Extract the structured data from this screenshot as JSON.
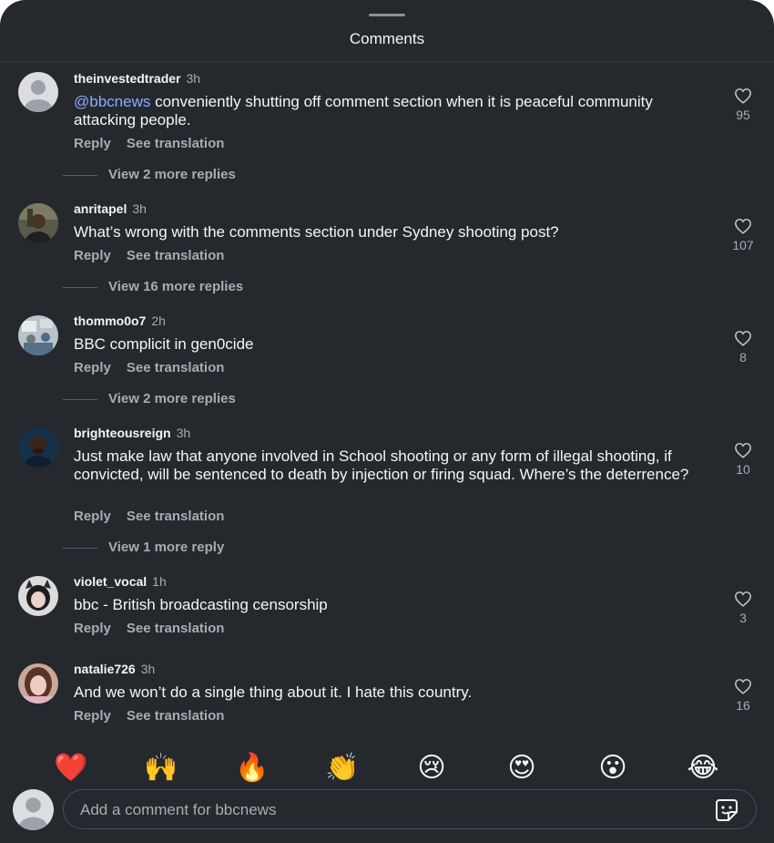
{
  "header": {
    "title": "Comments"
  },
  "comments": [
    {
      "username": "theinvestedtrader",
      "time": "3h",
      "mention": "@bbcnews",
      "text": " conveniently shutting off comment section when it is peaceful community attacking people.",
      "reply_label": "Reply",
      "translate_label": "See translation",
      "view_replies": "View 2 more replies",
      "likes": "95",
      "avatar": "default-avatar"
    },
    {
      "username": "anritapel",
      "time": "3h",
      "text": "What’s wrong with the comments section under Sydney shooting post?",
      "reply_label": "Reply",
      "translate_label": "See translation",
      "view_replies": "View 16 more replies",
      "likes": "107",
      "avatar": "photo-avatar"
    },
    {
      "username": "thommo0o7",
      "time": "2h",
      "text": "BBC complicit in gen0cide",
      "reply_label": "Reply",
      "translate_label": "See translation",
      "view_replies": "View 2 more replies",
      "likes": "8",
      "avatar": "photo-avatar"
    },
    {
      "username": "brighteousreign",
      "time": "3h",
      "text": "Just make law that anyone involved in School shooting or any form of illegal shooting, if convicted, will be sentenced to death by injection or firing squad. Where’s the deterrence?",
      "reply_label": "Reply",
      "translate_label": "See translation",
      "view_replies": "View 1 more reply",
      "likes": "10",
      "avatar": "photo-avatar"
    },
    {
      "username": "violet_vocal",
      "time": "1h",
      "text": "bbc - British broadcasting censorship",
      "reply_label": "Reply",
      "translate_label": "See translation",
      "likes": "3",
      "avatar": "photo-avatar"
    },
    {
      "username": "natalie726",
      "time": "3h",
      "text": "And we won’t do a single thing about it. I hate this country.",
      "reply_label": "Reply",
      "translate_label": "See translation",
      "likes": "16",
      "avatar": "photo-avatar"
    }
  ],
  "reactions": [
    {
      "name": "red-heart",
      "glyph": "❤️"
    },
    {
      "name": "raising-hands",
      "glyph": "🙌"
    },
    {
      "name": "fire",
      "glyph": "🔥"
    },
    {
      "name": "clapping-hands",
      "glyph": "👏"
    },
    {
      "name": "crying-face",
      "glyph": "😢"
    },
    {
      "name": "heart-eyes",
      "glyph": "😍"
    },
    {
      "name": "astonished-face",
      "glyph": "😮"
    },
    {
      "name": "tears-of-joy",
      "glyph": "😂"
    }
  ],
  "composer": {
    "placeholder": "Add a comment for bbcnews",
    "icon": "sticker-icon"
  },
  "colors": {
    "background": "#25292e",
    "text": "#f4f5f6",
    "secondary": "#a8acb1",
    "mention": "#8ea9ff"
  }
}
